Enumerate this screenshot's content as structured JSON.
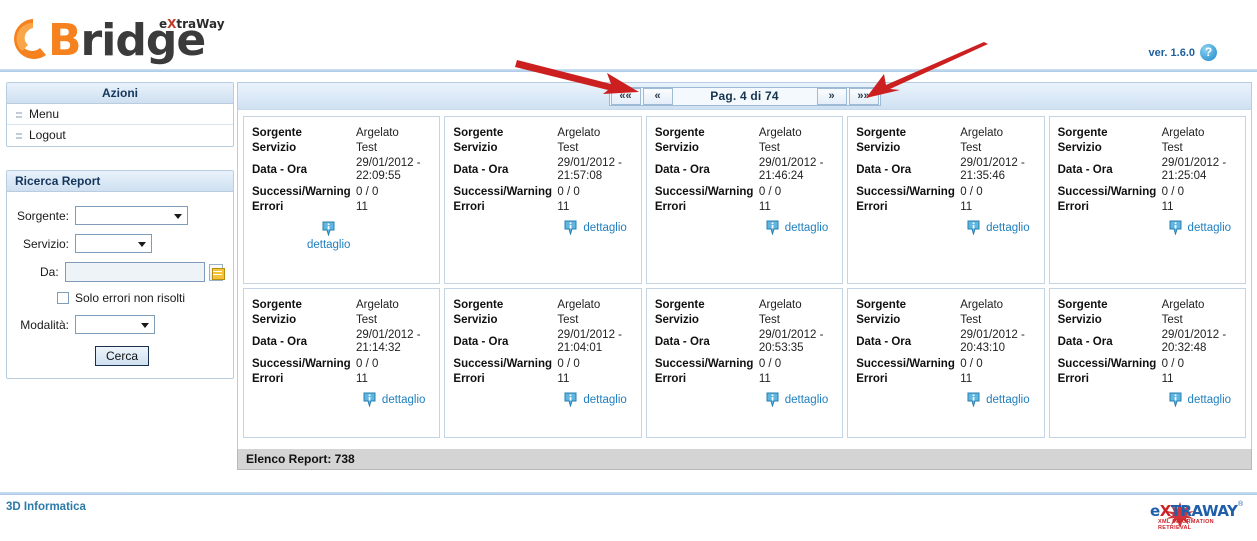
{
  "header": {
    "logo_b": "B",
    "logo_rest": "ridge",
    "logo_sup_pre": "e",
    "logo_sup_x": "X",
    "logo_sup_post": "traWay",
    "version": "ver. 1.6.0",
    "help_glyph": "?"
  },
  "sidebar": {
    "actions": {
      "title": "Azioni",
      "items": [
        {
          "label": "Menu"
        },
        {
          "label": "Logout"
        }
      ]
    },
    "search": {
      "title": "Ricerca Report",
      "sorgente_label": "Sorgente:",
      "sorgente_value": "",
      "servizio_label": "Servizio:",
      "servizio_value": "",
      "da_label": "Da:",
      "da_value": "",
      "calendar_icon": "calendar-icon",
      "checkbox_label": "Solo errori non risolti",
      "checkbox_checked": false,
      "modalita_label": "Modalità:",
      "modalita_value": "",
      "submit_label": "Cerca"
    }
  },
  "pager": {
    "first_label": "««",
    "prev_label": "«",
    "page_label": "Pag. 4 di 74",
    "next_label": "»",
    "last_label": "»»",
    "current_page": 4,
    "total_pages": 74
  },
  "card_fields": {
    "sorgente": "Sorgente",
    "servizio": "Servizio",
    "data_ora": "Data - Ora",
    "successi_warning": "Successi/Warning",
    "errori": "Errori",
    "detail_link": "dettaglio",
    "info_icon": "info-icon"
  },
  "cards": [
    {
      "sorgente": "Argelato",
      "servizio": "Test",
      "data": "29/01/2012 -",
      "ora": "22:09:55",
      "successi_warning": "0 / 0",
      "errori": "11",
      "detail": "dettaglio",
      "stacked": true
    },
    {
      "sorgente": "Argelato",
      "servizio": "Test",
      "data": "29/01/2012 -",
      "ora": "21:57:08",
      "successi_warning": "0 / 0",
      "errori": "11",
      "detail": "dettaglio",
      "stacked": false
    },
    {
      "sorgente": "Argelato",
      "servizio": "Test",
      "data": "29/01/2012 -",
      "ora": "21:46:24",
      "successi_warning": "0 / 0",
      "errori": "11",
      "detail": "dettaglio",
      "stacked": false
    },
    {
      "sorgente": "Argelato",
      "servizio": "Test",
      "data": "29/01/2012 -",
      "ora": "21:35:46",
      "successi_warning": "0 / 0",
      "errori": "11",
      "detail": "dettaglio",
      "stacked": false
    },
    {
      "sorgente": "Argelato",
      "servizio": "Test",
      "data": "29/01/2012 -",
      "ora": "21:25:04",
      "successi_warning": "0 / 0",
      "errori": "11",
      "detail": "dettaglio",
      "stacked": false
    },
    {
      "sorgente": "Argelato",
      "servizio": "Test",
      "data": "29/01/2012 -",
      "ora": "21:14:32",
      "successi_warning": "0 / 0",
      "errori": "11",
      "detail": "dettaglio",
      "stacked": false
    },
    {
      "sorgente": "Argelato",
      "servizio": "Test",
      "data": "29/01/2012 -",
      "ora": "21:04:01",
      "successi_warning": "0 / 0",
      "errori": "11",
      "detail": "dettaglio",
      "stacked": false
    },
    {
      "sorgente": "Argelato",
      "servizio": "Test",
      "data": "29/01/2012 -",
      "ora": "20:53:35",
      "successi_warning": "0 / 0",
      "errori": "11",
      "detail": "dettaglio",
      "stacked": false
    },
    {
      "sorgente": "Argelato",
      "servizio": "Test",
      "data": "29/01/2012 -",
      "ora": "20:43:10",
      "successi_warning": "0 / 0",
      "errori": "11",
      "detail": "dettaglio",
      "stacked": false
    },
    {
      "sorgente": "Argelato",
      "servizio": "Test",
      "data": "29/01/2012 -",
      "ora": "20:32:48",
      "successi_warning": "0 / 0",
      "errori": "11",
      "detail": "dettaglio",
      "stacked": false
    }
  ],
  "status": {
    "text": "Elenco Report: 738",
    "count": 738
  },
  "footer": {
    "left_text": "3D Informatica",
    "logo_pre": "e",
    "logo_x": "X",
    "logo_post": "TRAWAY",
    "logo_reg": "®",
    "logo_sub": "XML INFORMATION RETRIEVAL"
  },
  "annotations": {
    "arrow_color": "#cc2020",
    "arrows": [
      {
        "name": "arrow-pointing-to-pager-left"
      },
      {
        "name": "arrow-pointing-to-pager-right"
      }
    ]
  },
  "colors": {
    "accent_blue": "#1f7fbf",
    "panel_border": "#b8cde0",
    "brand_orange": "#F5821F",
    "status_bg": "#d4d4d4"
  }
}
